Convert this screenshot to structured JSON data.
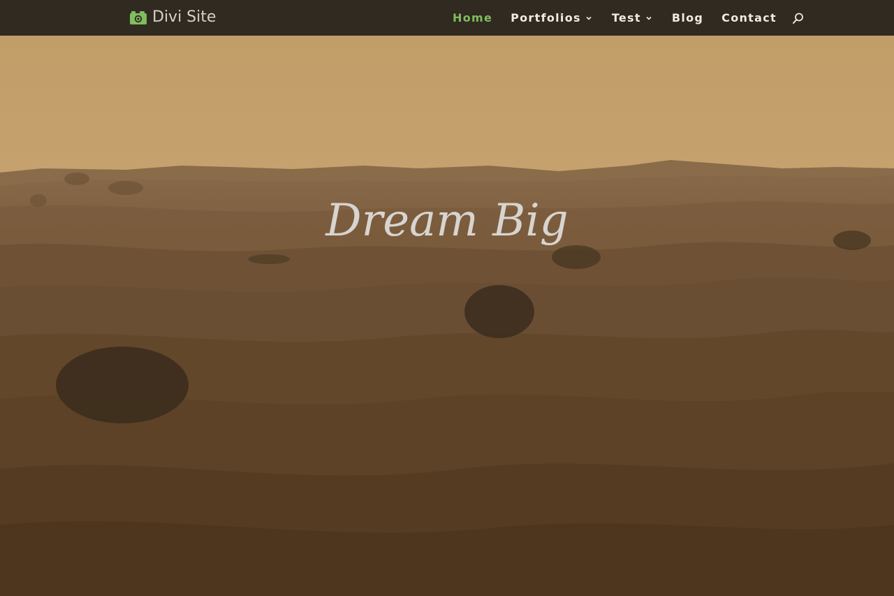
{
  "site": {
    "logo_icon": "camera-icon",
    "title": "Divi Site"
  },
  "nav": {
    "items": [
      {
        "label": "Home",
        "active": true,
        "dropdown": false
      },
      {
        "label": "Portfolios",
        "active": false,
        "dropdown": true
      },
      {
        "label": "Test",
        "active": false,
        "dropdown": true
      },
      {
        "label": "Blog",
        "active": false,
        "dropdown": false
      },
      {
        "label": "Contact",
        "active": false,
        "dropdown": false
      }
    ],
    "search_icon": "search-icon"
  },
  "hero": {
    "title": "Dream Big",
    "background": "desert-dunes-image"
  },
  "colors": {
    "header_bg": "#302a20",
    "accent": "#7fbd5e",
    "nav_text": "#f0ece2",
    "sky": "#c9a570",
    "sand": "#6e5234"
  }
}
